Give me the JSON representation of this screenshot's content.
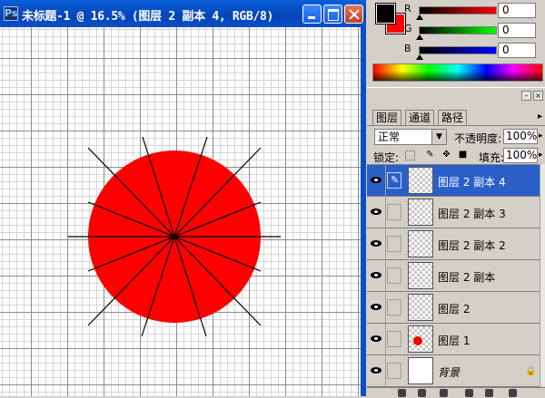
{
  "document": {
    "title": "未标题-1 @ 16.5% (图层 2 副本 4, RGB/8)",
    "icon_label": "Ps"
  },
  "canvas": {
    "circle_color": "#ff0000",
    "line_color": "#000000"
  },
  "color_panel": {
    "foreground": "#000000",
    "background": "#ff0000",
    "channels": [
      {
        "label": "R",
        "value": "0"
      },
      {
        "label": "G",
        "value": "0"
      },
      {
        "label": "B",
        "value": "0"
      }
    ]
  },
  "layers_panel": {
    "tabs": [
      "图层",
      "通道",
      "路径"
    ],
    "blend_mode": "正常",
    "opacity_label": "不透明度:",
    "opacity_value": "100%",
    "lock_label": "锁定:",
    "fill_label": "填充:",
    "fill_value": "100%",
    "layers": [
      {
        "name": "图层 2 副本 4",
        "selected": true,
        "thumb": "transparent"
      },
      {
        "name": "图层 2 副本 3",
        "selected": false,
        "thumb": "transparent"
      },
      {
        "name": "图层 2 副本 2",
        "selected": false,
        "thumb": "transparent"
      },
      {
        "name": "图层 2 副本",
        "selected": false,
        "thumb": "transparent"
      },
      {
        "name": "图层 2",
        "selected": false,
        "thumb": "transparent"
      },
      {
        "name": "图层 1",
        "selected": false,
        "thumb": "red-dot"
      },
      {
        "name": "背景",
        "selected": false,
        "thumb": "white",
        "locked": true
      }
    ]
  }
}
